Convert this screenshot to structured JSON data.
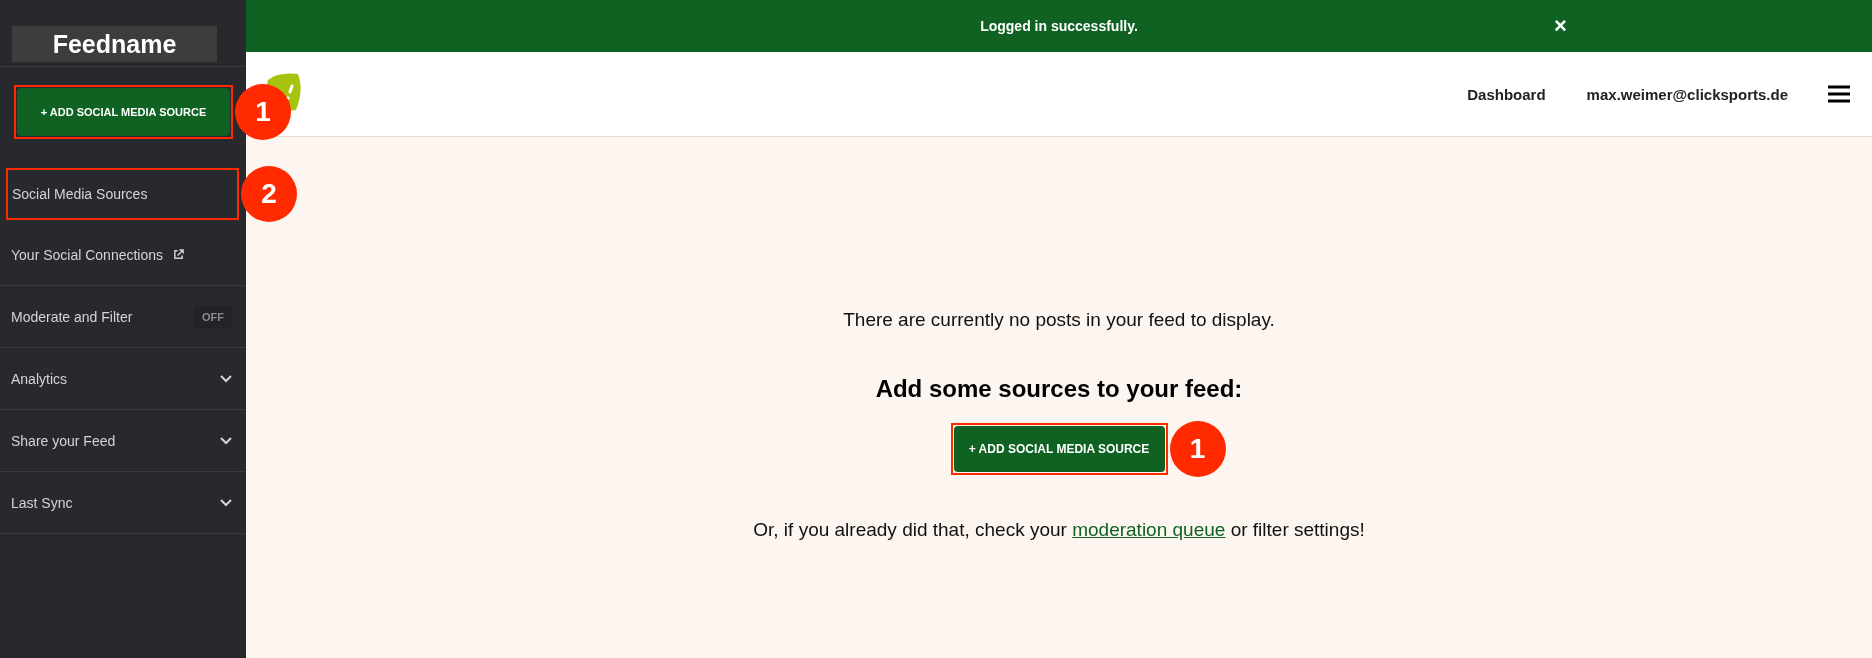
{
  "sidebar": {
    "feed_name": "Feedname",
    "add_button": {
      "label": "+ ADD SOCIAL MEDIA SOURCE",
      "annotation": "1"
    },
    "items": [
      {
        "label": "Social Media Sources",
        "annotation": "2"
      },
      {
        "label": "Your Social Connections",
        "kind": "external"
      },
      {
        "label": "Moderate and Filter",
        "kind": "toggle",
        "on": false,
        "toggle_label": "OFF"
      },
      {
        "label": "Analytics",
        "kind": "expandable",
        "expanded": false
      },
      {
        "label": "Share your Feed",
        "kind": "expandable",
        "expanded": false
      },
      {
        "label": "Last Sync",
        "kind": "expandable",
        "expanded": false
      }
    ]
  },
  "banner": {
    "message": "Logged in successfully.",
    "close": "×"
  },
  "header": {
    "nav": [
      "Dashboard",
      "max.weimer@clicksports.de"
    ]
  },
  "content": {
    "empty_message": "There are currently no posts in your feed to display.",
    "heading": "Add some sources to your feed:",
    "add_button": {
      "label": "+ ADD SOCIAL MEDIA SOURCE",
      "annotation": "1"
    },
    "hint_before": "Or, if you already did that, check your",
    "link": "moderation queue",
    "hint_after": "or filter settings!"
  }
}
